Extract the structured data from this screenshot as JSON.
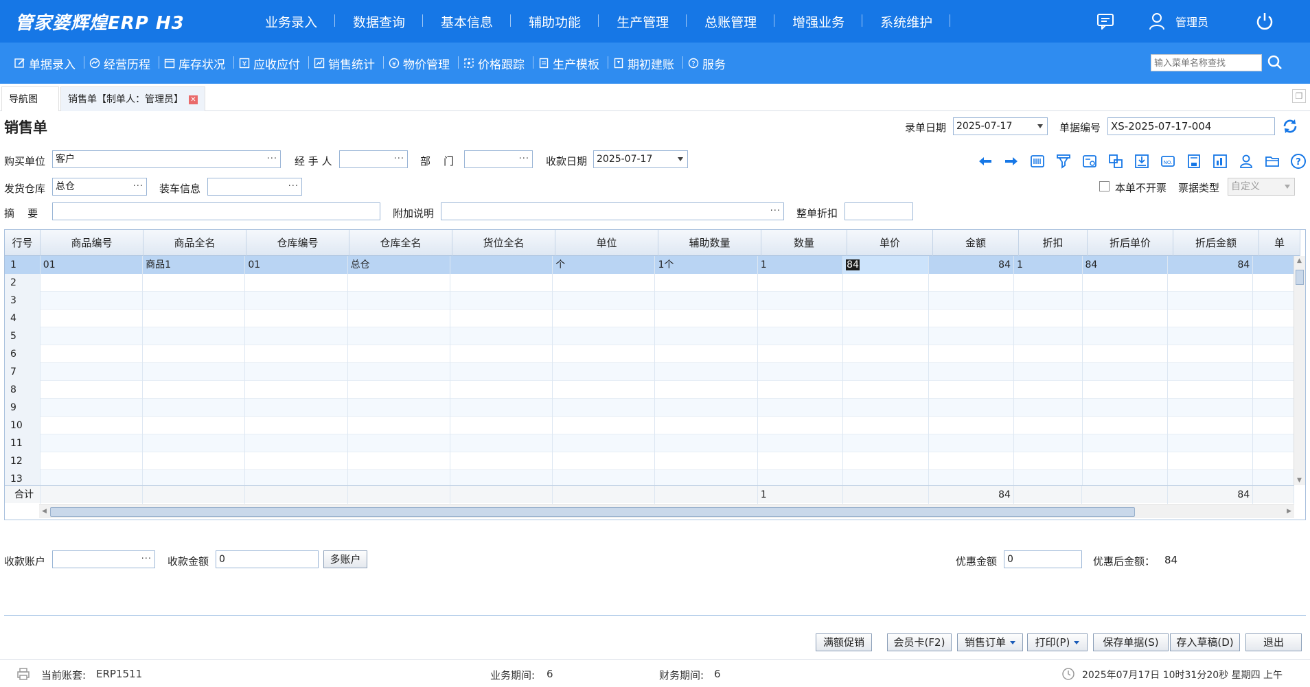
{
  "app": {
    "logo": "管家婆辉煌ERP H3",
    "topnav": [
      "业务录入",
      "数据查询",
      "基本信息",
      "辅助功能",
      "生产管理",
      "总账管理",
      "增强业务",
      "系统维护"
    ],
    "user": "管理员",
    "colors": {
      "primary": "#1677e6",
      "secondary": "#2f8cf0",
      "selected_row": "#b9d4f3"
    }
  },
  "secnav": [
    {
      "label": "单据录入",
      "icon": "edit-icon"
    },
    {
      "label": "经营历程",
      "icon": "history-icon"
    },
    {
      "label": "库存状况",
      "icon": "calendar-icon"
    },
    {
      "label": "应收应付",
      "icon": "money-icon"
    },
    {
      "label": "销售统计",
      "icon": "chart-icon"
    },
    {
      "label": "物价管理",
      "icon": "price-icon"
    },
    {
      "label": "价格跟踪",
      "icon": "track-icon"
    },
    {
      "label": "生产模板",
      "icon": "template-icon"
    },
    {
      "label": "期初建账",
      "icon": "book-icon"
    },
    {
      "label": "服务",
      "icon": "help-icon"
    }
  ],
  "menu_search": {
    "placeholder": "输入菜单名称查找"
  },
  "tabs": {
    "nav": "导航图",
    "active": "销售单【制单人：管理员】"
  },
  "form": {
    "title": "销售单",
    "entry_date_label": "录单日期",
    "entry_date": "2025-07-17",
    "doc_no_label": "单据编号",
    "doc_no": "XS-2025-07-17-004",
    "buyer_label": "购买单位",
    "buyer": "客户",
    "handler_label": "经 手 人",
    "handler": "",
    "dept_label": "部    门",
    "dept": "",
    "pay_date_label": "收款日期",
    "pay_date": "2025-07-17",
    "warehouse_label": "发货仓库",
    "warehouse": "总仓",
    "truck_label": "装车信息",
    "truck": "",
    "no_invoice_label": "本单不开票",
    "invoice_type_label": "票据类型",
    "invoice_type": "自定义",
    "summary_label": "摘    要",
    "summary": "",
    "extra_label": "附加说明",
    "extra": "",
    "discount_label": "整单折扣",
    "discount": ""
  },
  "grid": {
    "headers": [
      "行号",
      "商品编号",
      "商品全名",
      "仓库编号",
      "仓库全名",
      "货位全名",
      "单位",
      "辅助数量",
      "数量",
      "单价",
      "金额",
      "折扣",
      "折后单价",
      "折后金额",
      "单"
    ],
    "rows": [
      [
        "1",
        "01",
        "商品1",
        "01",
        "总仓",
        "",
        "个",
        "1个",
        "1",
        "84",
        "84",
        "1",
        "84",
        "84",
        ""
      ],
      [
        "2",
        "",
        "",
        "",
        "",
        "",
        "",
        "",
        "",
        "",
        "",
        "",
        "",
        "",
        ""
      ],
      [
        "3",
        "",
        "",
        "",
        "",
        "",
        "",
        "",
        "",
        "",
        "",
        "",
        "",
        "",
        ""
      ],
      [
        "4",
        "",
        "",
        "",
        "",
        "",
        "",
        "",
        "",
        "",
        "",
        "",
        "",
        "",
        ""
      ],
      [
        "5",
        "",
        "",
        "",
        "",
        "",
        "",
        "",
        "",
        "",
        "",
        "",
        "",
        "",
        ""
      ],
      [
        "6",
        "",
        "",
        "",
        "",
        "",
        "",
        "",
        "",
        "",
        "",
        "",
        "",
        "",
        ""
      ],
      [
        "7",
        "",
        "",
        "",
        "",
        "",
        "",
        "",
        "",
        "",
        "",
        "",
        "",
        "",
        ""
      ],
      [
        "8",
        "",
        "",
        "",
        "",
        "",
        "",
        "",
        "",
        "",
        "",
        "",
        "",
        "",
        ""
      ],
      [
        "9",
        "",
        "",
        "",
        "",
        "",
        "",
        "",
        "",
        "",
        "",
        "",
        "",
        "",
        ""
      ],
      [
        "10",
        "",
        "",
        "",
        "",
        "",
        "",
        "",
        "",
        "",
        "",
        "",
        "",
        "",
        ""
      ],
      [
        "11",
        "",
        "",
        "",
        "",
        "",
        "",
        "",
        "",
        "",
        "",
        "",
        "",
        "",
        ""
      ],
      [
        "12",
        "",
        "",
        "",
        "",
        "",
        "",
        "",
        "",
        "",
        "",
        "",
        "",
        "",
        ""
      ],
      [
        "13",
        "",
        "",
        "",
        "",
        "",
        "",
        "",
        "",
        "",
        "",
        "",
        "",
        "",
        ""
      ]
    ],
    "summary": {
      "label": "合计",
      "qty": "1",
      "amount": "84",
      "after_amount": "84"
    }
  },
  "payment": {
    "account_label": "收款账户",
    "account": "",
    "amount_label": "收款金额",
    "amount": "0",
    "multi_label": "多账户",
    "discount_label": "优惠金额",
    "discount": "0",
    "after_label": "优惠后金额：",
    "after": "84"
  },
  "buttons": {
    "promo": "满额促销",
    "member": "会员卡(F2)",
    "order": "销售订单",
    "print": "打印(P)",
    "save": "保存单据(S)",
    "draft": "存入草稿(D)",
    "exit": "退出"
  },
  "status": {
    "account_set_label": "当前账套:",
    "account_set": "ERP1511",
    "biz_period_label": "业务期间:",
    "biz_period": "6",
    "fin_period_label": "财务期间:",
    "fin_period": "6",
    "datetime": "2025年07月17日 10时31分20秒 星期四 上午"
  }
}
